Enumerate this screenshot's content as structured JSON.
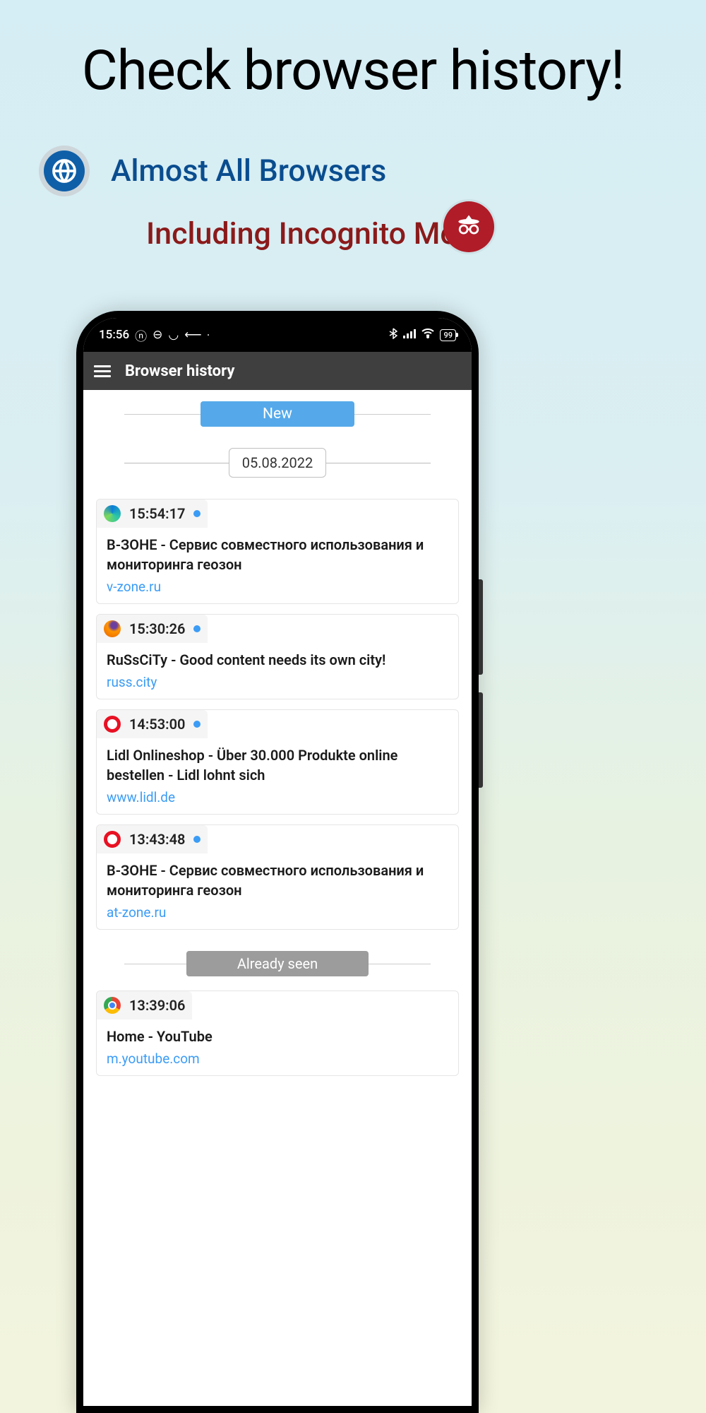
{
  "headline": "Check browser history!",
  "features": {
    "browsers": "Almost All Browsers",
    "incognito": "Including Incognito Mode"
  },
  "status": {
    "time": "15:56",
    "battery": "99"
  },
  "appbar": {
    "title": "Browser history"
  },
  "badges": {
    "new": "New",
    "already": "Already seen"
  },
  "date": "05.08.2022",
  "history": [
    {
      "browser": "edge",
      "time": "15:54:17",
      "unread": true,
      "title": "B-ЗОНЕ - Сервис совместного использования и мониторинга геозон",
      "url": "v-zone.ru"
    },
    {
      "browser": "firefox",
      "time": "15:30:26",
      "unread": true,
      "title": "RuSsCiTy - Good content needs its own city!",
      "url": "russ.city"
    },
    {
      "browser": "opera",
      "time": "14:53:00",
      "unread": true,
      "title": "Lidl Onlineshop - Über 30.000 Produkte online bestellen - Lidl lohnt sich",
      "url": "www.lidl.de"
    },
    {
      "browser": "opera",
      "time": "13:43:48",
      "unread": true,
      "title": "B-ЗОНЕ - Сервис совместного использования и мониторинга геозон",
      "url": "at-zone.ru"
    }
  ],
  "seen": [
    {
      "browser": "chrome",
      "time": "13:39:06",
      "unread": false,
      "title": "Home - YouTube",
      "url": "m.youtube.com"
    }
  ]
}
